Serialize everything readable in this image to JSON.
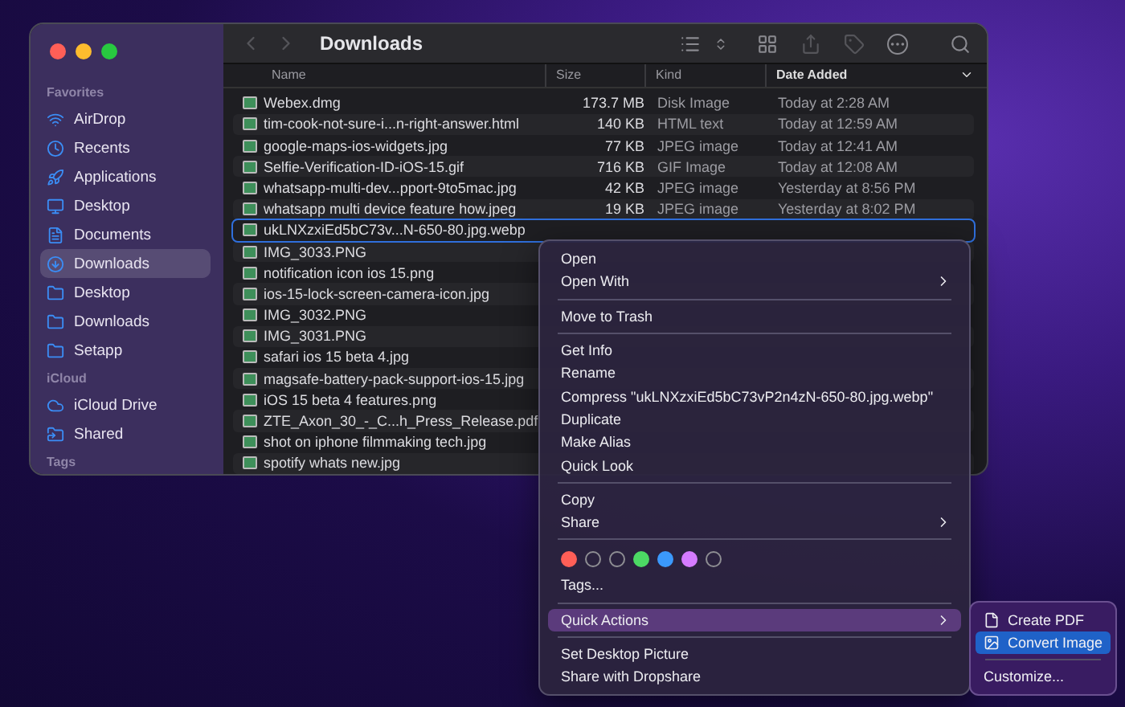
{
  "window": {
    "title": "Downloads"
  },
  "sidebar": {
    "sections": [
      {
        "title": "Favorites",
        "items": [
          {
            "label": "AirDrop",
            "selected": false
          },
          {
            "label": "Recents",
            "selected": false
          },
          {
            "label": "Applications",
            "selected": false
          },
          {
            "label": "Desktop",
            "selected": false
          },
          {
            "label": "Documents",
            "selected": false
          },
          {
            "label": "Downloads",
            "selected": true
          },
          {
            "label": "Desktop",
            "selected": false
          },
          {
            "label": "Downloads",
            "selected": false
          },
          {
            "label": "Setapp",
            "selected": false
          }
        ]
      },
      {
        "title": "iCloud",
        "items": [
          {
            "label": "iCloud Drive",
            "selected": false
          },
          {
            "label": "Shared",
            "selected": false
          }
        ]
      },
      {
        "title": "Tags"
      }
    ]
  },
  "table": {
    "columns": [
      {
        "label": "Name",
        "sorted": false
      },
      {
        "label": "Size",
        "sorted": false
      },
      {
        "label": "Kind",
        "sorted": false
      },
      {
        "label": "Date Added",
        "sorted": true
      }
    ],
    "rows": [
      {
        "name": "Webex.dmg",
        "size": "173.7 MB",
        "file_type": "Disk Image",
        "date": "Today at 2:28 AM",
        "selected": false
      },
      {
        "name": "tim-cook-not-sure-i...n-right-answer.html",
        "size": "140 KB",
        "file_type": "HTML text",
        "date": "Today at 12:59 AM",
        "selected": false
      },
      {
        "name": "google-maps-ios-widgets.jpg",
        "size": "77 KB",
        "file_type": "JPEG image",
        "date": "Today at 12:41 AM",
        "selected": false
      },
      {
        "name": "Selfie-Verification-ID-iOS-15.gif",
        "size": "716 KB",
        "file_type": "GIF Image",
        "date": "Today at 12:08 AM",
        "selected": false
      },
      {
        "name": "whatsapp-multi-dev...pport-9to5mac.jpg",
        "size": "42 KB",
        "file_type": "JPEG image",
        "date": "Yesterday at 8:56 PM",
        "selected": false
      },
      {
        "name": "whatsapp multi device feature how.jpeg",
        "size": "19 KB",
        "file_type": "JPEG image",
        "date": "Yesterday at 8:02 PM",
        "selected": false
      },
      {
        "name": "ukLNXzxiEd5bC73v...N-650-80.jpg.webp",
        "selected": true
      },
      {
        "name": "IMG_3033.PNG",
        "selected": false
      },
      {
        "name": "notification icon ios 15.png",
        "selected": false
      },
      {
        "name": "ios-15-lock-screen-camera-icon.jpg",
        "selected": false
      },
      {
        "name": "IMG_3032.PNG",
        "selected": false
      },
      {
        "name": "IMG_3031.PNG",
        "selected": false
      },
      {
        "name": "safari ios 15 beta 4.jpg",
        "selected": false
      },
      {
        "name": "magsafe-battery-pack-support-ios-15.jpg",
        "selected": false
      },
      {
        "name": "iOS 15 beta 4 features.png",
        "selected": false
      },
      {
        "name": "ZTE_Axon_30_-_C...h_Press_Release.pdf",
        "selected": false
      },
      {
        "name": "shot on iphone filmmaking tech.jpg",
        "selected": false
      },
      {
        "name": "spotify whats new.jpg",
        "selected": false
      }
    ]
  },
  "context_menu": {
    "groups": [
      [
        {
          "label": "Open",
          "submenu": false,
          "selected": false
        },
        {
          "label": "Open With",
          "submenu": true,
          "selected": false
        }
      ],
      [
        {
          "label": "Move to Trash",
          "submenu": false,
          "selected": false
        }
      ],
      [
        {
          "label": "Get Info",
          "submenu": false,
          "selected": false
        },
        {
          "label": "Rename",
          "submenu": false,
          "selected": false
        },
        {
          "label": "Compress \"ukLNXzxiEd5bC73vP2n4zN-650-80.jpg.webp\"",
          "submenu": false,
          "selected": false
        },
        {
          "label": "Duplicate",
          "submenu": false,
          "selected": false
        },
        {
          "label": "Make Alias",
          "submenu": false,
          "selected": false
        },
        {
          "label": "Quick Look",
          "submenu": false,
          "selected": false
        }
      ],
      [
        {
          "label": "Copy",
          "submenu": false,
          "selected": false
        },
        {
          "label": "Share",
          "submenu": true,
          "selected": false
        }
      ]
    ],
    "tag_colors": [
      {
        "color": "#ff5f57",
        "kind": "filled"
      },
      {
        "color": "#8e8e93",
        "kind": "outline"
      },
      {
        "color": "#8e8e93",
        "kind": "outline"
      },
      {
        "color": "#4cd964",
        "kind": "filled"
      },
      {
        "color": "#3b99fc",
        "kind": "filled"
      },
      {
        "color": "#d57bff",
        "kind": "filled"
      },
      {
        "color": "#8e8e93",
        "kind": "outline"
      }
    ],
    "tags_label": "Tags...",
    "tail_groups": [
      [
        {
          "label": "Quick Actions",
          "submenu": true,
          "selected": true
        }
      ],
      [
        {
          "label": "Set Desktop Picture",
          "submenu": false,
          "selected": false
        },
        {
          "label": "Share with Dropshare",
          "submenu": false,
          "selected": false
        }
      ]
    ]
  },
  "submenu": {
    "items": [
      {
        "label": "Create PDF",
        "selected": false
      },
      {
        "label": "Convert Image",
        "selected": true
      }
    ],
    "footer": "Customize..."
  }
}
